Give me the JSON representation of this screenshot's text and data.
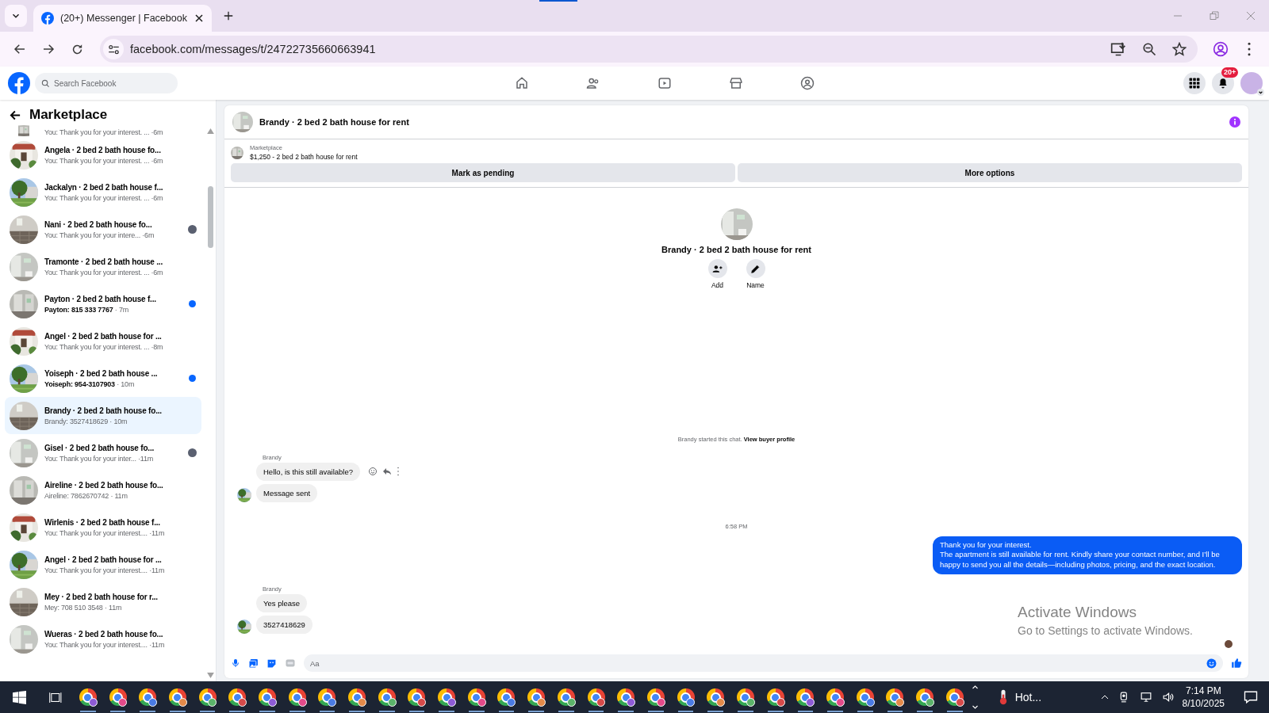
{
  "browser": {
    "tab_title": "(20+) Messenger | Facebook",
    "url": "facebook.com/messages/t/24722735660663941"
  },
  "header": {
    "search_placeholder": "Search Facebook",
    "notification_badge": "20+"
  },
  "sidebar": {
    "title": "Marketplace",
    "conversations": [
      {
        "kind": "partial",
        "preview": "You: Thank you for your interest. ...",
        "time": "·6m",
        "unread": false,
        "seen": false,
        "selected": false
      },
      {
        "kind": "full",
        "name": "Angela · 2 bed 2 bath house fo...",
        "preview": "You: Thank you for your interest. ...",
        "time": "·6m",
        "unread": false,
        "seen": false,
        "selected": false
      },
      {
        "kind": "full",
        "name": "Jackalyn · 2 bed 2 bath house f...",
        "preview": "You: Thank you for your interest. ...",
        "time": "·6m",
        "unread": false,
        "seen": false,
        "selected": false
      },
      {
        "kind": "full",
        "name": "Nani · 2 bed 2 bath house fo...",
        "preview": "You: Thank you for your intere...",
        "time": "·6m",
        "unread": false,
        "seen": true,
        "selected": false
      },
      {
        "kind": "full",
        "name": "Tramonte · 2 bed 2 bath house ...",
        "preview": "You: Thank you for your interest. ...",
        "time": "·6m",
        "unread": false,
        "seen": false,
        "selected": false
      },
      {
        "kind": "full",
        "name": "Payton · 2 bed 2 bath house f...",
        "preview": "Payton: 815 333 7767",
        "time": "· 7m",
        "unread": true,
        "seen": false,
        "selected": false
      },
      {
        "kind": "full",
        "name": "Angel · 2 bed 2 bath house for ...",
        "preview": "You: Thank you for your interest. ...",
        "time": "·8m",
        "unread": false,
        "seen": false,
        "selected": false
      },
      {
        "kind": "full",
        "name": "Yoiseph · 2 bed 2 bath house ...",
        "preview": "Yoiseph: 954-3107903",
        "time": "· 10m",
        "unread": true,
        "seen": false,
        "selected": false
      },
      {
        "kind": "full",
        "name": "Brandy · 2 bed 2 bath house fo...",
        "preview": "Brandy: 3527418629",
        "time": "· 10m",
        "unread": false,
        "seen": false,
        "selected": true
      },
      {
        "kind": "full",
        "name": "Gisel · 2 bed 2 bath house fo...",
        "preview": "You: Thank you for your inter...",
        "time": "·11m",
        "unread": false,
        "seen": true,
        "selected": false
      },
      {
        "kind": "full",
        "name": "Aireline · 2 bed 2 bath house fo...",
        "preview": "Aireline: 7862670742",
        "time": "· 11m",
        "unread": false,
        "seen": false,
        "selected": false
      },
      {
        "kind": "full",
        "name": "Wirlenis · 2 bed 2 bath house f...",
        "preview": "You: Thank you for your interest....",
        "time": "·11m",
        "unread": false,
        "seen": false,
        "selected": false
      },
      {
        "kind": "full",
        "name": "Angel · 2 bed 2 bath house for ...",
        "preview": "You: Thank you for your interest....",
        "time": "·11m",
        "unread": false,
        "seen": false,
        "selected": false
      },
      {
        "kind": "full",
        "name": "Mey · 2 bed 2 bath house for r...",
        "preview": "Mey: 708 510 3548",
        "time": "· 11m",
        "unread": false,
        "seen": false,
        "selected": false
      },
      {
        "kind": "full",
        "name": "Wueras · 2 bed 2 bath house fo...",
        "preview": "You: Thank you for your interest....",
        "time": "·11m",
        "unread": false,
        "seen": false,
        "selected": false
      }
    ]
  },
  "chat": {
    "title": "Brandy · 2 bed 2 bath house for rent",
    "listing_label": "Marketplace",
    "listing": "$1,250 - 2 bed 2 bath house for rent",
    "actions": [
      "Mark as pending",
      "More options"
    ],
    "profile_name": "Brandy · 2 bed 2 bath house for rent",
    "profile_actions": [
      "Add",
      "Name"
    ],
    "messages": [
      {
        "kind": "system",
        "text": "Brandy started this chat.",
        "link": "View buyer profile"
      },
      {
        "kind": "sender",
        "text": "Brandy"
      },
      {
        "kind": "incoming",
        "text": "Hello, is this still available?",
        "avatar": false,
        "hover_actions": true
      },
      {
        "kind": "incoming",
        "text": "Message sent",
        "avatar": true,
        "hover_actions": false
      },
      {
        "kind": "time",
        "text": "6:58 PM"
      },
      {
        "kind": "outgoing",
        "text": "Thank you for your interest.\nThe apartment is still available for rent. Kindly share your contact number, and I’ll be happy to send you all the details—including photos, pricing, and the exact location."
      },
      {
        "kind": "sender",
        "text": "Brandy"
      },
      {
        "kind": "incoming",
        "text": "Yes please",
        "avatar": false,
        "hover_actions": false
      },
      {
        "kind": "incoming",
        "text": "3527418629",
        "avatar": true,
        "hover_actions": false
      }
    ],
    "read_receipt": true,
    "composer_placeholder": "Aa"
  },
  "os_notice": {
    "title": "Activate Windows",
    "text": "Go to Settings to activate Windows."
  },
  "taskbar": {
    "weather": "Hot...",
    "time": "7:14 PM",
    "date": "8/10/2025"
  }
}
